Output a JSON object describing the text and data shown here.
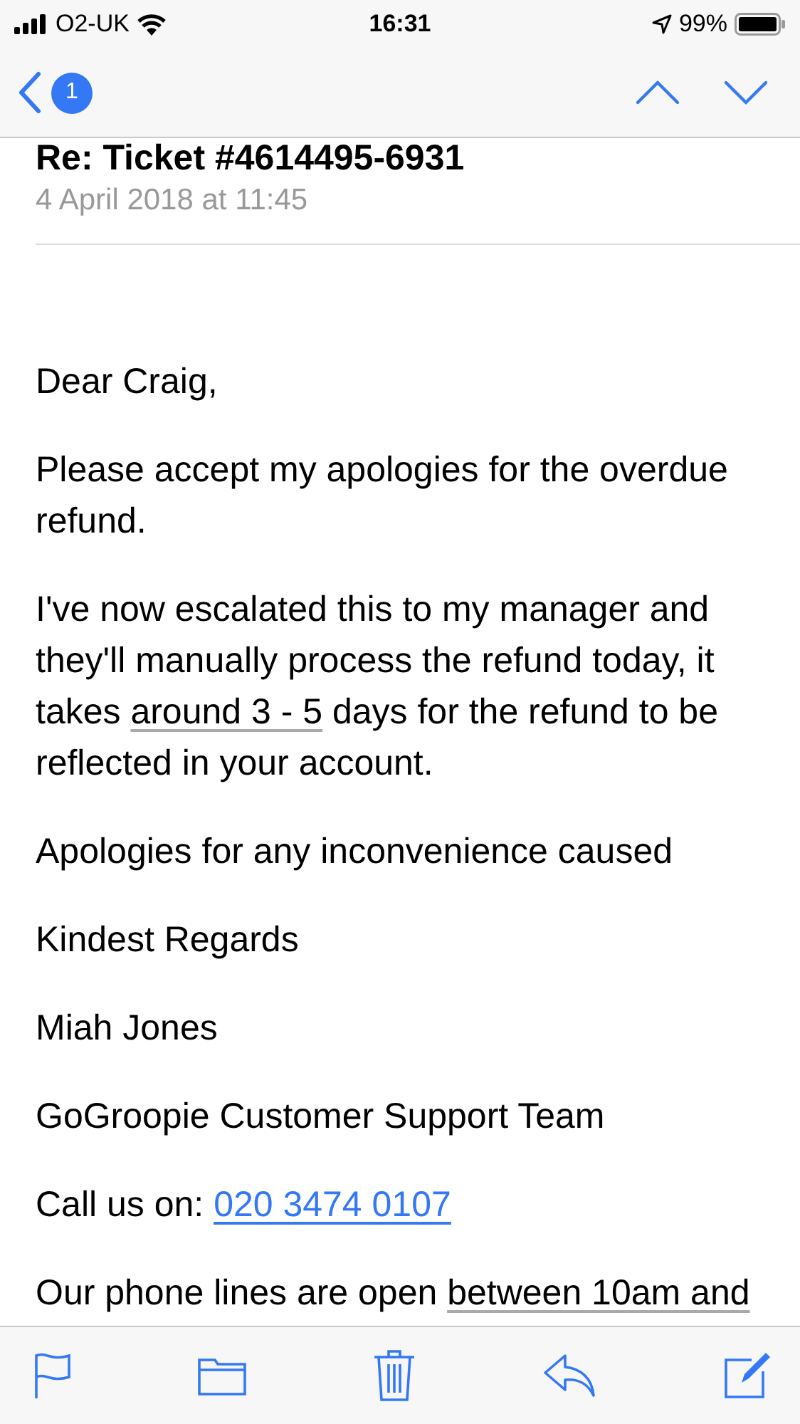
{
  "status_bar": {
    "carrier": "O2-UK",
    "time": "16:31",
    "battery": "99%"
  },
  "nav": {
    "badge": "1"
  },
  "message": {
    "subject": "Re: Ticket #4614495-6931",
    "date": "4 April 2018 at 11:45",
    "paragraphs": [
      [
        {
          "kind": "plain",
          "text": "Dear Craig,"
        }
      ],
      [
        {
          "kind": "plain",
          "text": "Please accept my apologies for the overdue refund."
        }
      ],
      [
        {
          "kind": "plain",
          "text": "I've now escalated this to my manager and they'll manually process the refund today, it takes "
        },
        {
          "kind": "detected",
          "text": "around 3 - 5"
        },
        {
          "kind": "plain",
          "text": " days for the refund to be reflected in your account."
        }
      ],
      [
        {
          "kind": "plain",
          "text": "Apologies for any inconvenience caused"
        }
      ],
      [
        {
          "kind": "plain",
          "text": "Kindest Regards"
        }
      ],
      [
        {
          "kind": "plain",
          "text": "Miah Jones"
        }
      ],
      [
        {
          "kind": "plain",
          "text": "GoGroopie Customer Support Team"
        }
      ],
      [
        {
          "kind": "plain",
          "text": "Call us on: "
        },
        {
          "kind": "link",
          "text": "020 3474 0107"
        }
      ],
      [
        {
          "kind": "plain",
          "text": "Our phone lines are open "
        },
        {
          "kind": "detected",
          "text": "between 10am and"
        }
      ]
    ]
  }
}
